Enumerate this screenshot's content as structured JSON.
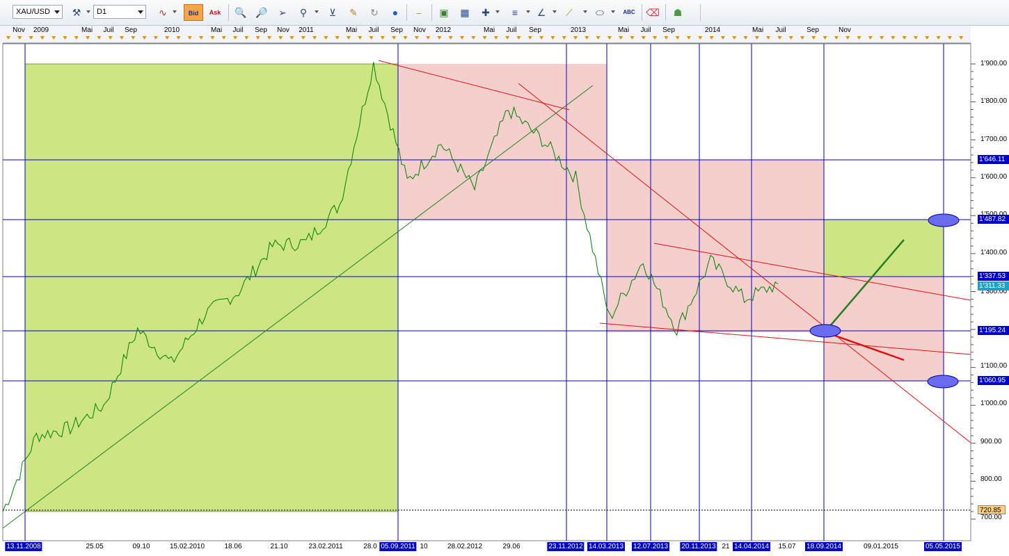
{
  "toolbar": {
    "symbol": "XAU/USD",
    "timeframe": "D1",
    "bid_label": "Bid",
    "ask_label": "Ask",
    "abc_label": "ABC",
    "icons": [
      "chart-type-icon",
      "bid-button",
      "ask-button",
      "zoom-in-icon",
      "zoom-out-icon",
      "pointer-icon",
      "magnifier-icon",
      "crosshair-icon",
      "note-icon",
      "refresh-icon",
      "globe-icon",
      "ruler-icon",
      "image-icon",
      "layout-icon",
      "tools-icon",
      "line-style-icon",
      "fibonacci-icon",
      "pen-icon",
      "ellipse-icon",
      "text-icon",
      "eraser-icon",
      "hierarchy-icon"
    ]
  },
  "colors": {
    "green_zone": "#cde683",
    "red_zone": "#f5cfcb",
    "price_line": "#008000",
    "trendline": "#e01010",
    "horizontal_line": "#0000c8",
    "highlight_box": "#0000c8"
  },
  "time_axis_top": [
    "Nov",
    "2009",
    "Mai",
    "Juil",
    "Sep",
    "2010",
    "Mai",
    "Juil",
    "Sep",
    "Nov",
    "2011",
    "Mai",
    "Juil",
    "Sep",
    "Nov",
    "2012",
    "Mai",
    "Juil",
    "Sep",
    "2013",
    "Mai",
    "Juil",
    "Sep",
    "2014",
    "Mai",
    "Juil",
    "Sep",
    "Nov"
  ],
  "time_axis_bottom": {
    "plain": [
      "25.05",
      "09.10",
      "15.02.2010",
      "18.06",
      "21.10",
      "23.02.2011",
      "28.0",
      "10",
      "28.02.2012",
      "29.06",
      "21",
      "15.07",
      "09.01.2015"
    ],
    "highlighted": [
      "13.11.2008",
      "05.09.2011",
      "23.11.2012",
      "14.03.2013",
      "12.07.2013",
      "20.11.2013",
      "14.04.2014",
      "18.09.2014",
      "05.05.2015"
    ]
  },
  "price_axis": {
    "labels": [
      "1'900.00",
      "1'800.00",
      "1'700.00",
      "1'600.00",
      "1'500.00",
      "1'400.00",
      "1'300.00",
      "1'100.00",
      "1'000.00",
      "900.00",
      "800.00",
      "700.00"
    ],
    "levels": [
      "1'646.11",
      "1'487.82",
      "1'337.53",
      "1'195.24",
      "1'060.95"
    ],
    "current_price": "1'311.33",
    "low_level": "720.85"
  },
  "chart_data": {
    "type": "line",
    "instrument": "XAU/USD",
    "timeframe": "D1",
    "x": [
      "2008-11",
      "2009-03",
      "2009-06",
      "2009-09",
      "2009-12",
      "2010-03",
      "2010-06",
      "2010-09",
      "2010-12",
      "2011-03",
      "2011-06",
      "2011-09",
      "2011-12",
      "2012-03",
      "2012-06",
      "2012-09",
      "2012-12",
      "2013-03",
      "2013-06",
      "2013-09",
      "2013-12",
      "2014-03",
      "2014-06",
      "2014-07"
    ],
    "series": [
      {
        "values": [
          720,
          920,
          940,
          1000,
          1200,
          1110,
          1240,
          1300,
          1420,
          1430,
          1530,
          1900,
          1590,
          1690,
          1570,
          1780,
          1700,
          1600,
          1230,
          1380,
          1200,
          1380,
          1280,
          1320
        ]
      }
    ],
    "horizontal_levels": [
      1646.11,
      1487.82,
      1337.53,
      1195.24,
      1060.95,
      720.85
    ],
    "ylim": [
      650,
      1950
    ],
    "grid": false
  }
}
